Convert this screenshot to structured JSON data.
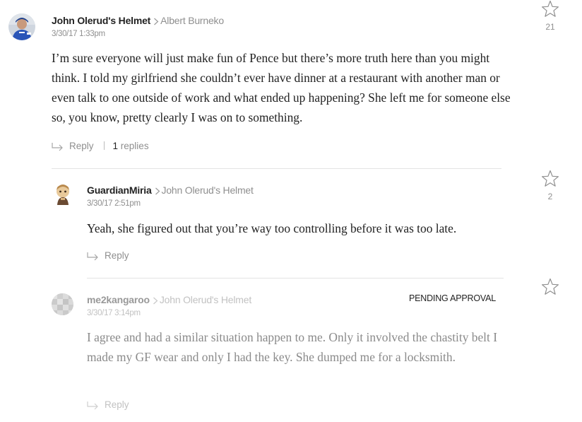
{
  "comments": [
    {
      "author": "John Olerud's Helmet",
      "reply_to": "Albert Burneko",
      "timestamp": "3/30/17 1:33pm",
      "body": "I’m sure everyone will just make fun of Pence but there’s more truth here than you might think. I told my girlfriend she couldn’t ever have dinner at a restaurant with another man or even talk to one outside of work and what ended up happening? She left me for someone else so, you know, pretty clearly I was on to something.",
      "reply_label": "Reply",
      "replies_number": "1",
      "replies_word": "replies",
      "star_count": "21"
    },
    {
      "author": "GuardianMiria",
      "reply_to": "John Olerud's Helmet",
      "timestamp": "3/30/17 2:51pm",
      "body": "Yeah, she figured out that you’re way too controlling before it was too late.",
      "reply_label": "Reply",
      "star_count": "2"
    },
    {
      "author": "me2kangaroo",
      "reply_to": "John Olerud's Helmet",
      "timestamp": "3/30/17 3:14pm",
      "status": "PENDING APPROVAL",
      "body": "I agree and had a similar situation happen to me. Only it involved the chastity belt I made my GF wear and only I had the key. She dumped me for a locksmith.",
      "reply_label": "Reply"
    }
  ]
}
